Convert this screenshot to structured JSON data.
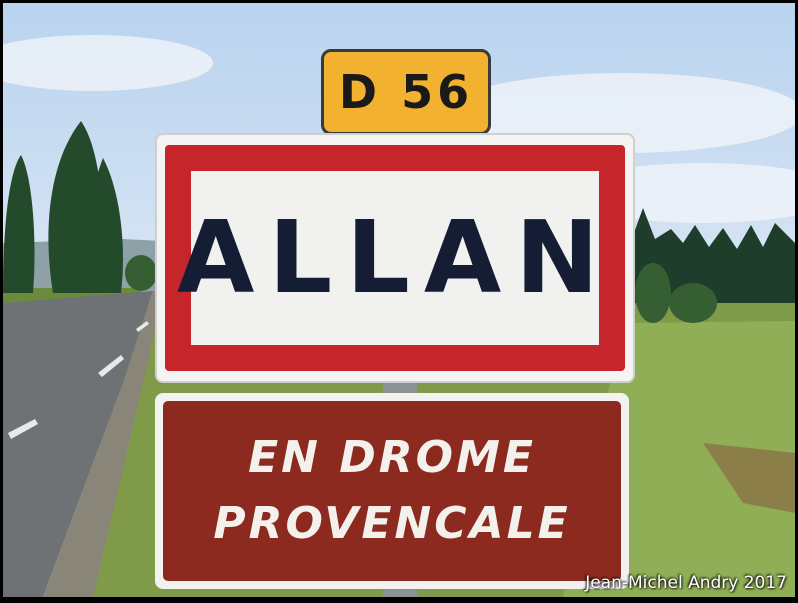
{
  "route_plate": {
    "text": "D 56",
    "color": "#f2b12e"
  },
  "town_sign": {
    "name": "ALLAN",
    "border_color": "#c4262c"
  },
  "region_sign": {
    "lines": [
      "EN DROME",
      "PROVENCALE"
    ],
    "panel_color": "#8c2a1f"
  },
  "credit": "Jean-Michel Andry 2017"
}
